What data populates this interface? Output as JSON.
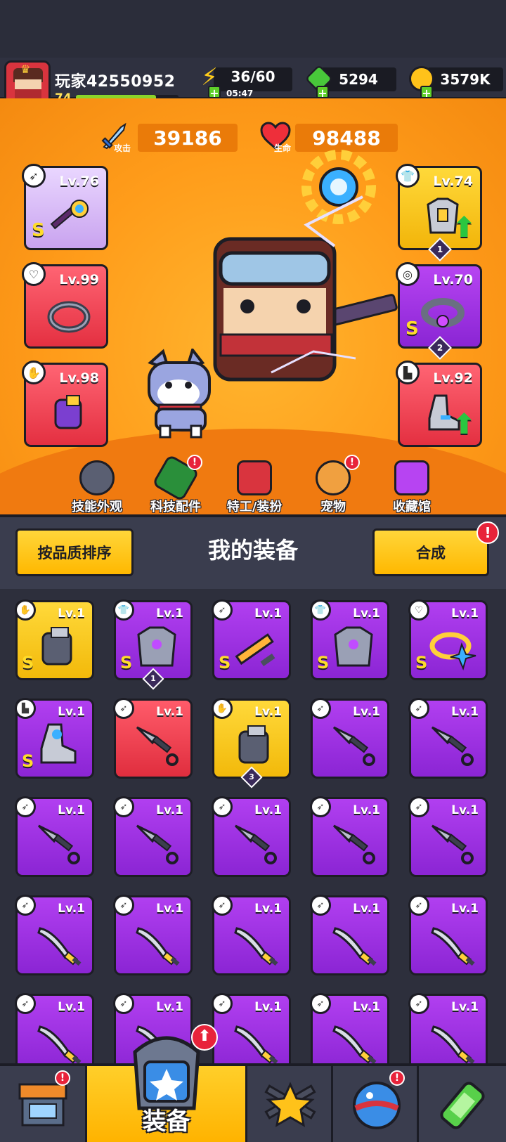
{
  "player": {
    "name": "玩家42550952",
    "level": "74",
    "xp_fraction": 0.78
  },
  "resources": {
    "energy": {
      "value": "36/60",
      "timer": "05:47"
    },
    "gems": {
      "value": "5294"
    },
    "coins": {
      "value": "3579K"
    }
  },
  "stats": {
    "attack": {
      "label": "攻击",
      "value": "39186"
    },
    "hp": {
      "label": "生命",
      "value": "98488"
    }
  },
  "equipped": {
    "weapon": {
      "level": "Lv.76",
      "rarity": "S",
      "icon": "staff-icon"
    },
    "necklace": {
      "level": "Lv.99",
      "icon": "spiked-collar-icon"
    },
    "gloves": {
      "level": "Lv.98",
      "icon": "gauntlet-icon"
    },
    "armor": {
      "level": "Lv.74",
      "count": "1",
      "icon": "armor-icon",
      "upgradable": true
    },
    "belt": {
      "level": "Lv.70",
      "rarity": "S",
      "count": "2",
      "icon": "belt-icon"
    },
    "boots": {
      "level": "Lv.92",
      "icon": "boot-icon",
      "upgradable": true
    }
  },
  "features": [
    {
      "label": "技能外观",
      "icon": "skill-skin-icon",
      "alert": false
    },
    {
      "label": "科技配件",
      "icon": "tech-part-icon",
      "alert": true
    },
    {
      "label": "特工/装扮",
      "icon": "agent-outfit-icon",
      "alert": false
    },
    {
      "label": "宠物",
      "icon": "pet-icon",
      "alert": true
    },
    {
      "label": "收藏馆",
      "icon": "collection-icon",
      "alert": false
    }
  ],
  "equipment_section": {
    "sort_label": "按品质排序",
    "title": "我的装备",
    "merge_label": "合成",
    "alert": "!"
  },
  "inventory": [
    {
      "level": "Lv.1",
      "rarity": "S",
      "color": "yellow",
      "icon": "gauntlet-icon"
    },
    {
      "level": "Lv.1",
      "rarity": "S",
      "color": "purple",
      "icon": "armor-icon",
      "count": "1"
    },
    {
      "level": "Lv.1",
      "rarity": "S",
      "color": "purple",
      "icon": "sword-icon"
    },
    {
      "level": "Lv.1",
      "rarity": "S",
      "color": "purple",
      "icon": "armor-icon"
    },
    {
      "level": "Lv.1",
      "rarity": "S",
      "color": "purple",
      "icon": "ring-icon"
    },
    {
      "level": "Lv.1",
      "rarity": "S",
      "color": "purple",
      "icon": "boot-icon"
    },
    {
      "level": "Lv.1",
      "color": "red",
      "icon": "kunai-icon"
    },
    {
      "level": "Lv.1",
      "color": "yellow",
      "icon": "gauntlet-icon",
      "count": "3"
    },
    {
      "level": "Lv.1",
      "color": "purple",
      "icon": "kunai-icon"
    },
    {
      "level": "Lv.1",
      "color": "purple",
      "icon": "kunai-icon"
    },
    {
      "level": "Lv.1",
      "color": "purple",
      "icon": "kunai-icon"
    },
    {
      "level": "Lv.1",
      "color": "purple",
      "icon": "kunai-icon"
    },
    {
      "level": "Lv.1",
      "color": "purple",
      "icon": "kunai-icon"
    },
    {
      "level": "Lv.1",
      "color": "purple",
      "icon": "kunai-icon"
    },
    {
      "level": "Lv.1",
      "color": "purple",
      "icon": "kunai-icon"
    },
    {
      "level": "Lv.1",
      "color": "purple",
      "icon": "katana-icon"
    },
    {
      "level": "Lv.1",
      "color": "purple",
      "icon": "katana-icon"
    },
    {
      "level": "Lv.1",
      "color": "purple",
      "icon": "katana-icon"
    },
    {
      "level": "Lv.1",
      "color": "purple",
      "icon": "katana-icon"
    },
    {
      "level": "Lv.1",
      "color": "purple",
      "icon": "katana-icon"
    },
    {
      "level": "Lv.1",
      "color": "purple",
      "icon": "katana-icon"
    },
    {
      "level": "Lv.1",
      "color": "purple",
      "icon": "katana-icon"
    },
    {
      "level": "Lv.1",
      "color": "purple",
      "icon": "katana-icon"
    },
    {
      "level": "Lv.1",
      "color": "purple",
      "icon": "katana-icon"
    },
    {
      "level": "Lv.1",
      "color": "purple",
      "icon": "katana-icon"
    }
  ],
  "nav": [
    {
      "icon": "shop-icon",
      "label": "",
      "alert": true
    },
    {
      "icon": "equipment-icon",
      "label": "装备",
      "active": true,
      "alert": true
    },
    {
      "icon": "battle-icon",
      "label": ""
    },
    {
      "icon": "planet-icon",
      "label": "",
      "alert": true
    },
    {
      "icon": "dna-icon",
      "label": ""
    }
  ],
  "colors": {
    "accent": "#ffc21a",
    "purple": "#a533e8",
    "red": "#f0424f",
    "yellow": "#ffd22e"
  }
}
